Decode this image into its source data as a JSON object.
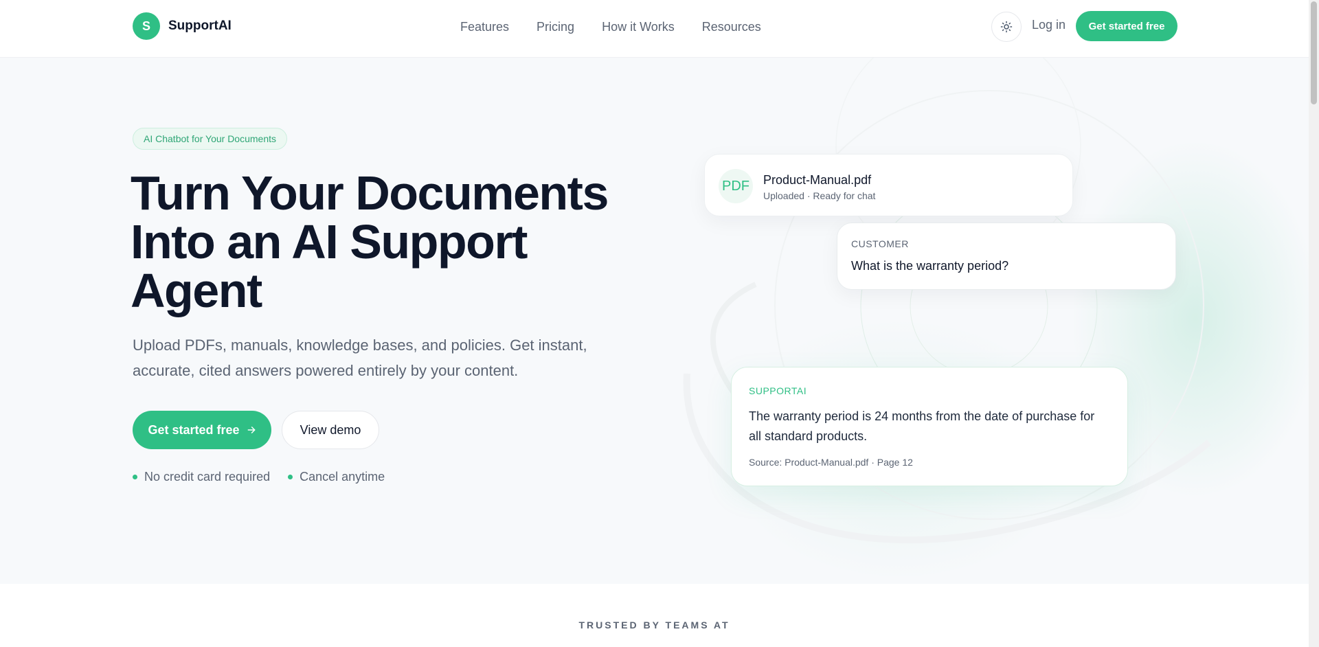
{
  "brand": {
    "logo_letter": "S",
    "name": "SupportAI",
    "accent": "#2fbf85"
  },
  "nav": {
    "items": [
      {
        "label": "Features"
      },
      {
        "label": "Pricing"
      },
      {
        "label": "How it Works"
      },
      {
        "label": "Resources"
      }
    ],
    "theme_icon": "sun-icon",
    "login": "Log in",
    "cta": "Get started free"
  },
  "hero": {
    "badge": "AI Chatbot for Your Documents",
    "headline_lines": [
      "Turn Your Documents",
      "Into an AI Support",
      "Agent"
    ],
    "subtext": "Upload PDFs, manuals, knowledge bases, and policies. Get instant, accurate, cited answers powered entirely by your content.",
    "primary_cta": "Get started free",
    "primary_cta_icon": "arrow-right-icon",
    "secondary_cta": "View demo",
    "perks": [
      "No credit card required",
      "Cancel anytime"
    ]
  },
  "preview": {
    "file": {
      "icon_label": "PDF",
      "name": "Product-Manual.pdf",
      "status": "Uploaded · Ready for chat"
    },
    "customer": {
      "label": "CUSTOMER",
      "question": "What is the warranty period?"
    },
    "ai": {
      "label": "SUPPORTAI",
      "answer": "The warranty period is 24 months from the date of purchase for all standard products.",
      "source": "Source: Product-Manual.pdf · Page 12"
    }
  },
  "trusted": {
    "label": "TRUSTED BY TEAMS AT"
  }
}
